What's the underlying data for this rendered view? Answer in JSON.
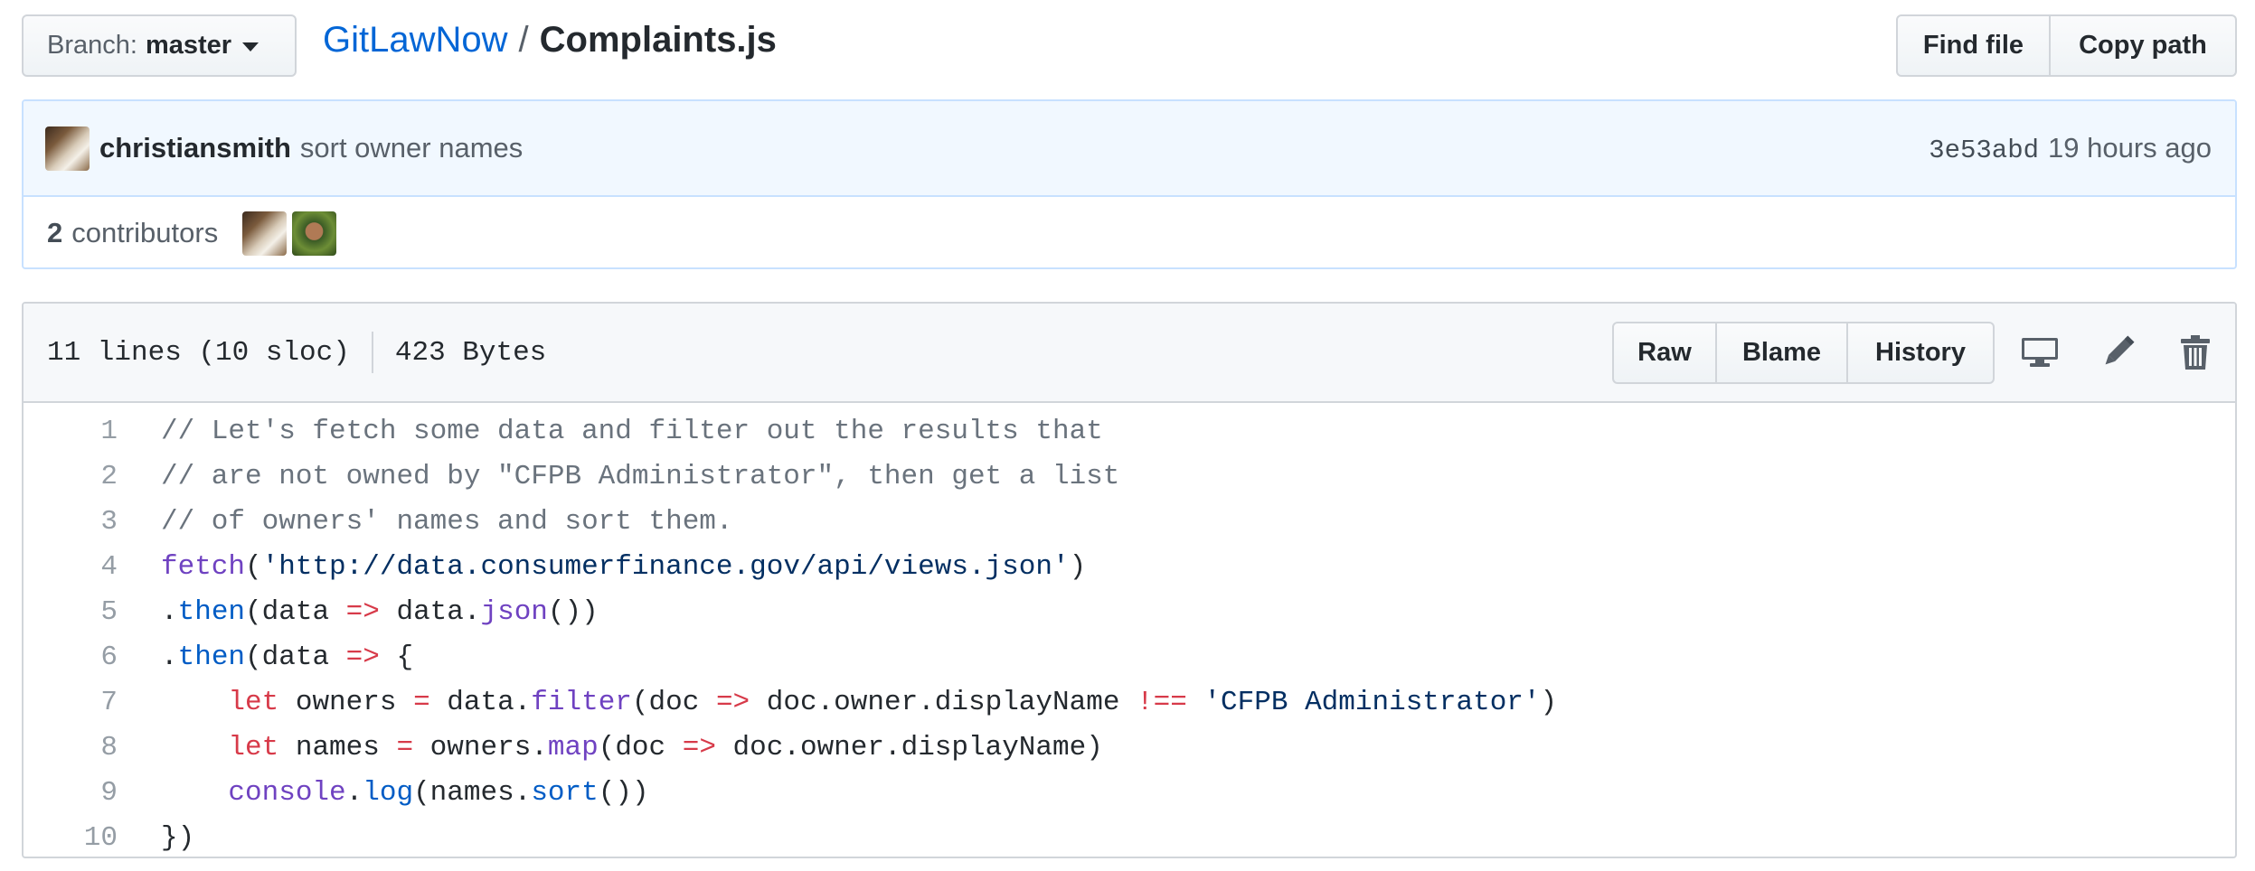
{
  "branch": {
    "label": "Branch:",
    "value": "master"
  },
  "breadcrumb": {
    "repo": "GitLawNow",
    "separator": "/",
    "file": "Complaints.js"
  },
  "top_actions": {
    "find_file": "Find file",
    "copy_path": "Copy path"
  },
  "commit": {
    "author": "christiansmith",
    "message": "sort owner names",
    "sha": "3e53abd",
    "time": "19 hours ago"
  },
  "contributors": {
    "count": "2",
    "label": "contributors"
  },
  "file": {
    "lines_info": "11 lines (10 sloc)",
    "size": "423 Bytes",
    "buttons": {
      "raw": "Raw",
      "blame": "Blame",
      "history": "History"
    },
    "icons": [
      "desktop-icon",
      "pencil-icon",
      "trash-icon"
    ]
  },
  "code": [
    {
      "n": "1",
      "tokens": [
        [
          "c",
          "// Let's fetch some data and filter out the results that"
        ]
      ]
    },
    {
      "n": "2",
      "tokens": [
        [
          "c",
          "// are not owned by \"CFPB Administrator\", then get a list"
        ]
      ]
    },
    {
      "n": "3",
      "tokens": [
        [
          "c",
          "// of owners' names and sort them."
        ]
      ]
    },
    {
      "n": "4",
      "tokens": [
        [
          "f",
          "fetch"
        ],
        [
          "p",
          "("
        ],
        [
          "s",
          "'http://data.consumerfinance.gov/api/views.json'"
        ],
        [
          "p",
          ")"
        ]
      ]
    },
    {
      "n": "5",
      "tokens": [
        [
          "p",
          "."
        ],
        [
          "b",
          "then"
        ],
        [
          "p",
          "(data "
        ],
        [
          "k",
          "=>"
        ],
        [
          "p",
          " data."
        ],
        [
          "f",
          "json"
        ],
        [
          "p",
          "())"
        ]
      ]
    },
    {
      "n": "6",
      "tokens": [
        [
          "p",
          "."
        ],
        [
          "b",
          "then"
        ],
        [
          "p",
          "(data "
        ],
        [
          "k",
          "=>"
        ],
        [
          "p",
          " {"
        ]
      ]
    },
    {
      "n": "7",
      "tokens": [
        [
          "p",
          "    "
        ],
        [
          "k",
          "let"
        ],
        [
          "p",
          " owners "
        ],
        [
          "k",
          "="
        ],
        [
          "p",
          " data."
        ],
        [
          "f",
          "filter"
        ],
        [
          "p",
          "(doc "
        ],
        [
          "k",
          "=>"
        ],
        [
          "p",
          " doc.owner.displayName "
        ],
        [
          "k",
          "!=="
        ],
        [
          "p",
          " "
        ],
        [
          "s",
          "'CFPB Administrator'"
        ],
        [
          "p",
          ")"
        ]
      ]
    },
    {
      "n": "8",
      "tokens": [
        [
          "p",
          "    "
        ],
        [
          "k",
          "let"
        ],
        [
          "p",
          " names "
        ],
        [
          "k",
          "="
        ],
        [
          "p",
          " owners."
        ],
        [
          "f",
          "map"
        ],
        [
          "p",
          "(doc "
        ],
        [
          "k",
          "=>"
        ],
        [
          "p",
          " doc.owner.displayName)"
        ]
      ]
    },
    {
      "n": "9",
      "tokens": [
        [
          "p",
          "    "
        ],
        [
          "f",
          "console"
        ],
        [
          "p",
          "."
        ],
        [
          "b",
          "log"
        ],
        [
          "p",
          "(names."
        ],
        [
          "b",
          "sort"
        ],
        [
          "p",
          "())"
        ]
      ]
    },
    {
      "n": "10",
      "tokens": [
        [
          "p",
          "})"
        ]
      ]
    }
  ],
  "colors": {
    "link": "#0366d6",
    "comment": "#6a737d",
    "string": "#032f62",
    "function": "#6f42c1",
    "keyword": "#d73a49",
    "property": "#005cc5"
  }
}
